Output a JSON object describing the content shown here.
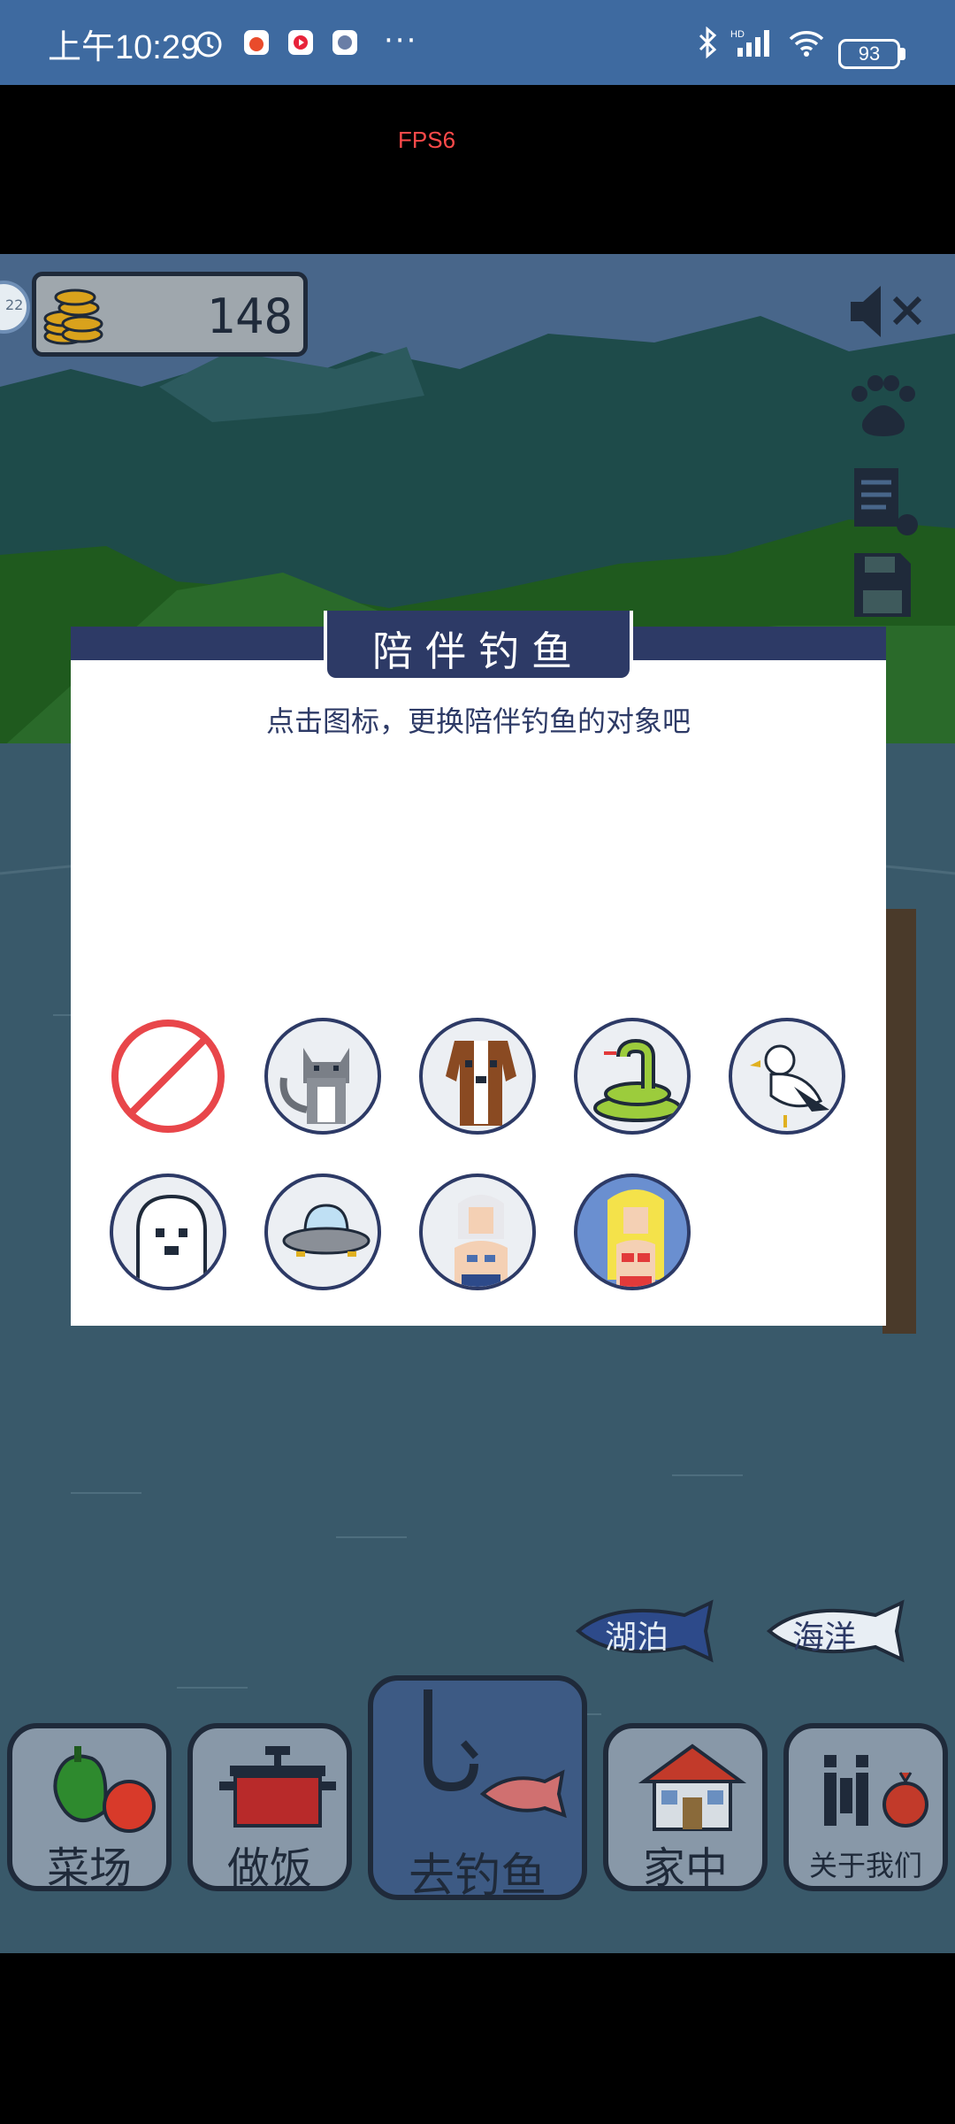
{
  "status_bar": {
    "time": "上午10:29",
    "more": "···",
    "battery": "93"
  },
  "overlay": {
    "fps": "FPS6"
  },
  "hud": {
    "coins": "148",
    "level_badge": "22"
  },
  "dialog": {
    "title": "陪伴钓鱼",
    "subtitle": "点击图标，更换陪伴钓鱼的对象吧",
    "companions": [
      {
        "name": "none",
        "icon": "no-companion-icon"
      },
      {
        "name": "cat",
        "icon": "cat-icon"
      },
      {
        "name": "dog",
        "icon": "beagle-icon"
      },
      {
        "name": "snake",
        "icon": "snake-icon"
      },
      {
        "name": "seagull",
        "icon": "seagull-icon"
      },
      {
        "name": "ghost",
        "icon": "ghost-icon"
      },
      {
        "name": "ufo",
        "icon": "ufo-icon"
      },
      {
        "name": "old-mermaid",
        "icon": "white-hair-mermaid-icon"
      },
      {
        "name": "mermaid",
        "icon": "blonde-mermaid-icon"
      }
    ]
  },
  "locations": {
    "lake": "湖泊",
    "ocean": "海洋"
  },
  "nav": {
    "farm": "菜场",
    "cook": "做饭",
    "fish": "去钓鱼",
    "home": "家中",
    "about": "关于我们"
  },
  "colors": {
    "accent": "#2d3a66",
    "status_bar": "#3e6aa0",
    "fps": "#ff4a4a"
  }
}
